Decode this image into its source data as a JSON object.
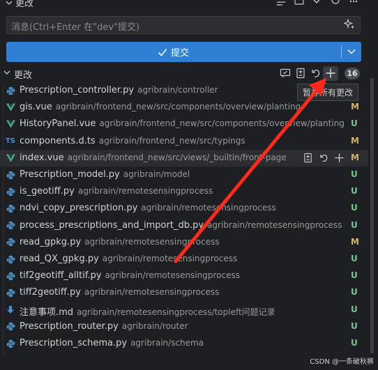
{
  "header": {
    "title": "更改",
    "icons": [
      "list-icon",
      "comment-icon",
      "check-icon",
      "refresh-icon",
      "more-icon"
    ]
  },
  "message": {
    "placeholder": "消息(Ctrl+Enter 在\"dev\"提交)"
  },
  "commit": {
    "label": "提交"
  },
  "changes": {
    "title": "更改",
    "count": "16",
    "tooltip": "暂存所有更改"
  },
  "files": [
    {
      "name": "Prescription_controller.py",
      "path": "agribrain/controller",
      "status": "",
      "type": "py"
    },
    {
      "name": "gis.vue",
      "path": "agribrain/frontend_new/src/components/overview/planting",
      "status": "M",
      "type": "vue"
    },
    {
      "name": "HistoryPanel.vue",
      "path": "agribrain/frontend_new/src/components/overview/planting",
      "status": "U",
      "type": "vue"
    },
    {
      "name": "components.d.ts",
      "path": "agribrain/frontend_new/src/typings",
      "status": "M",
      "type": "ts"
    },
    {
      "name": "index.vue",
      "path": "agribrain/frontend_new/src/views/_builtin/front-page",
      "status": "M",
      "type": "vue"
    },
    {
      "name": "Prescription_model.py",
      "path": "agribrain/model",
      "status": "U",
      "type": "py"
    },
    {
      "name": "is_geotiff.py",
      "path": "agribrain/remotesensingprocess",
      "status": "U",
      "type": "py"
    },
    {
      "name": "ndvi_copy_prescription.py",
      "path": "agribrain/remotesensingprocess",
      "status": "U",
      "type": "py"
    },
    {
      "name": "process_prescriptions_and_import_db.py",
      "path": "agribrain/remotesensingprocess",
      "status": "U",
      "type": "py"
    },
    {
      "name": "read_gpkg.py",
      "path": "agribrain/remotesensingprocess",
      "status": "M",
      "type": "py"
    },
    {
      "name": "read_QX_gpkg.py",
      "path": "agribrain/remotesensingprocess",
      "status": "U",
      "type": "py"
    },
    {
      "name": "tif2geotiff_alltif.py",
      "path": "agribrain/remotesensingprocess",
      "status": "U",
      "type": "py"
    },
    {
      "name": "tiff2geotiff.py",
      "path": "agribrain/remotesensingprocess",
      "status": "U",
      "type": "py"
    },
    {
      "name": "注意事项.md",
      "path": "agribrain/remotesensingprocess/topleft问题记录",
      "status": "U",
      "type": "md"
    },
    {
      "name": "Prescription_router.py",
      "path": "agribrain/router",
      "status": "U",
      "type": "py"
    },
    {
      "name": "Prescription_schema.py",
      "path": "agribrain/schema",
      "status": "U",
      "type": "py"
    }
  ],
  "colors": {
    "accent": "#2f7fd4",
    "modified": "#d5b26a",
    "untracked": "#73c991",
    "python": "#4b8bbe",
    "vue": "#41b883",
    "ts": "#4a90d9",
    "md": "#4a90d9",
    "annotation": "#ff2a1a"
  },
  "watermark": "CSDN @一条破秋裤"
}
